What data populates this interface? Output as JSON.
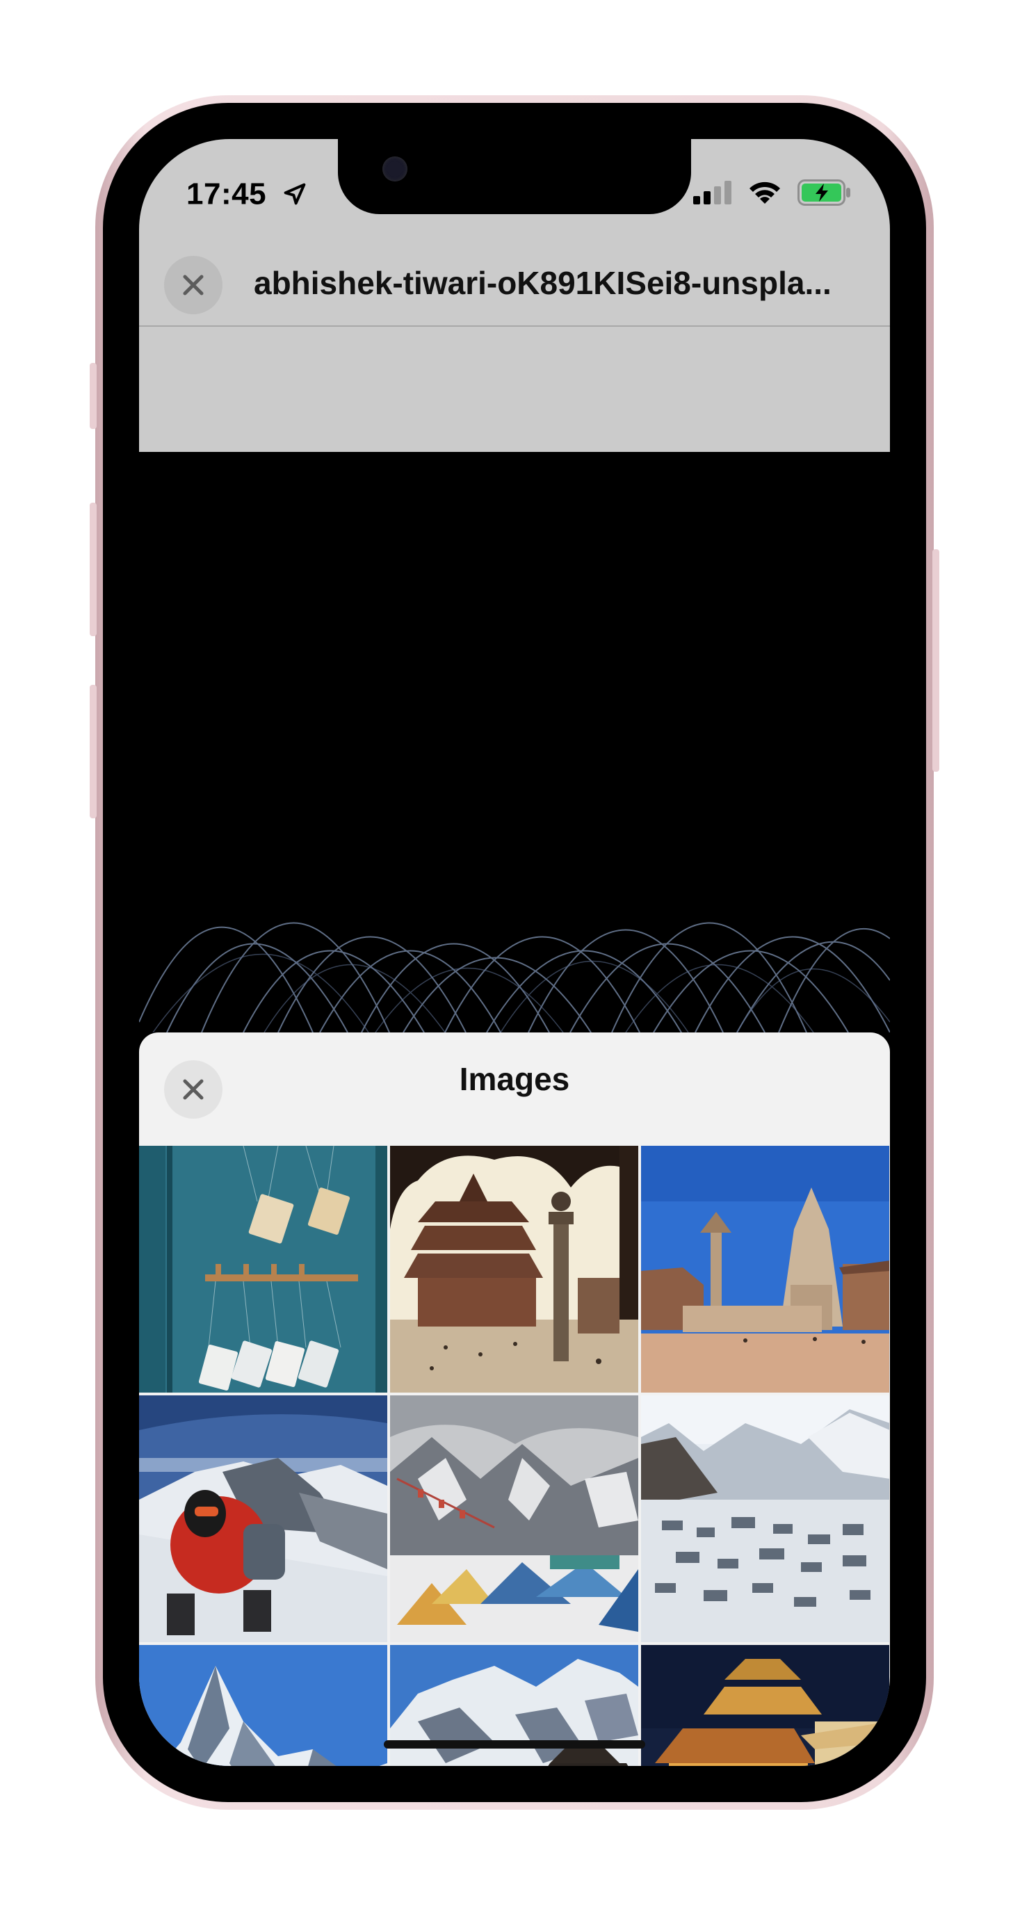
{
  "status_bar": {
    "time": "17:45",
    "location_icon": "location-arrow-icon",
    "signal_icon": "cellular-signal-icon",
    "wifi_icon": "wifi-icon",
    "battery_icon": "battery-charging-icon"
  },
  "document": {
    "title": "abhishek-tiwari-oK891KISei8-unspla...",
    "close_icon": "close-icon"
  },
  "images_sheet": {
    "title": "Images",
    "close_icon": "close-icon",
    "thumbnails": [
      {
        "name": "hanging-books-on-teal-wall"
      },
      {
        "name": "pagoda-temple-square"
      },
      {
        "name": "bhaktapur-durbar-square"
      },
      {
        "name": "climber-on-summit"
      },
      {
        "name": "tents-in-snowy-mountains"
      },
      {
        "name": "snowy-mountain-village"
      },
      {
        "name": "fishtail-mountain-peak"
      },
      {
        "name": "snowy-peaks-with-pagoda"
      },
      {
        "name": "illuminated-temple-at-night"
      }
    ]
  },
  "colors": {
    "top_sheet_bg": "#cbcbcb",
    "images_sheet_bg": "#f2f2f2",
    "battery_green": "#34c759"
  }
}
